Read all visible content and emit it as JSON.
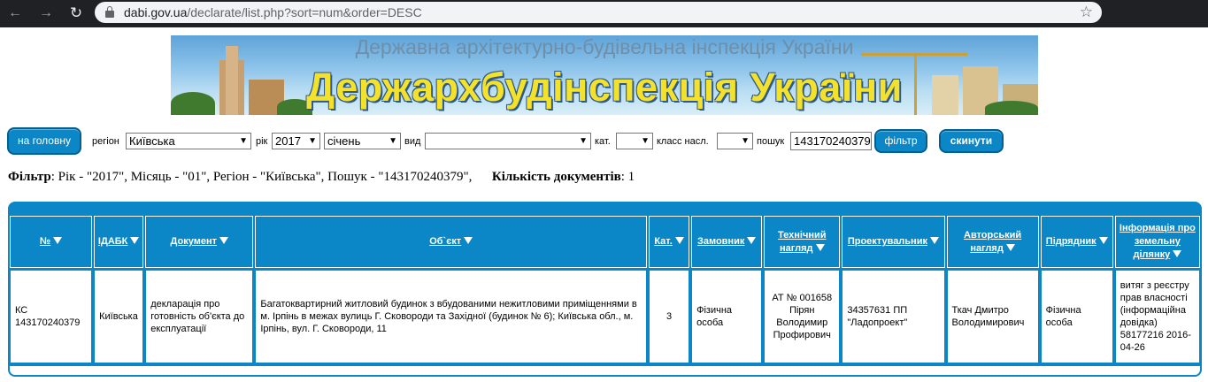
{
  "browser": {
    "url_host": "dabi.gov.ua",
    "url_path": "/declarate/list.php?sort=num&order=DESC"
  },
  "banner": {
    "subtitle": "Державна архітектурно-будівельна інспекція України",
    "title": "Держархбудінспекція України"
  },
  "toolbar": {
    "home_label": "на головну",
    "region_label": "регіон",
    "region_value": "Київська",
    "year_label": "рік",
    "year_value": "2017",
    "month_value": "січень",
    "type_label": "вид",
    "type_value": "",
    "cat_label": "кат.",
    "cat_value": "",
    "class_label": "класс насл.",
    "class_value": "",
    "search_label": "пошук",
    "search_value": "143170240379",
    "filter_label": "фільтр",
    "reset_label": "скинути"
  },
  "summary": {
    "filter_label": "Фільтр",
    "filter_text": ": Рік - \"2017\", Місяць - \"01\", Регіон - \"Київська\", Пошук - \"143170240379\",",
    "count_label": "Кількість документів",
    "count_text": ": 1"
  },
  "table": {
    "headers": [
      "№",
      "ІДАБК",
      "Документ",
      "Об`єкт",
      "Кат.",
      "Замовник",
      "Технічний нагляд",
      "Проектувальник",
      "Авторський нагляд",
      "Підрядник",
      "Інформація про земельну ділянку"
    ],
    "rows": [
      {
        "num": "КС 143170240379",
        "idabk": "Київська",
        "document": "декларація про готовність об'єкта до експлуатації",
        "object": "Багатоквартирний житловий будинок з вбудованими нежитловими приміщеннями в м. Ірпінь в межах вулиць Г. Сковороди та Західної (будинок № 6); Київська обл., м. Ірпінь, вул. Г. Сковороди, 11",
        "category": "3",
        "customer": "Фізична особа",
        "tech_supervision": "АТ № 001658 Пірян Володимир Профирович",
        "designer": "34357631 ПП \"Ладопроект\"",
        "author_supervision": "Ткач Дмитро Володимирович",
        "contractor": "Фізична особа",
        "land_info": "витяг з реєстру прав власності (інформаційна довідка) 58177216 2016-04-26"
      }
    ]
  },
  "colors": {
    "accent": "#0b86c6",
    "chrome": "#202124",
    "banner_title": "#f4e12c"
  }
}
